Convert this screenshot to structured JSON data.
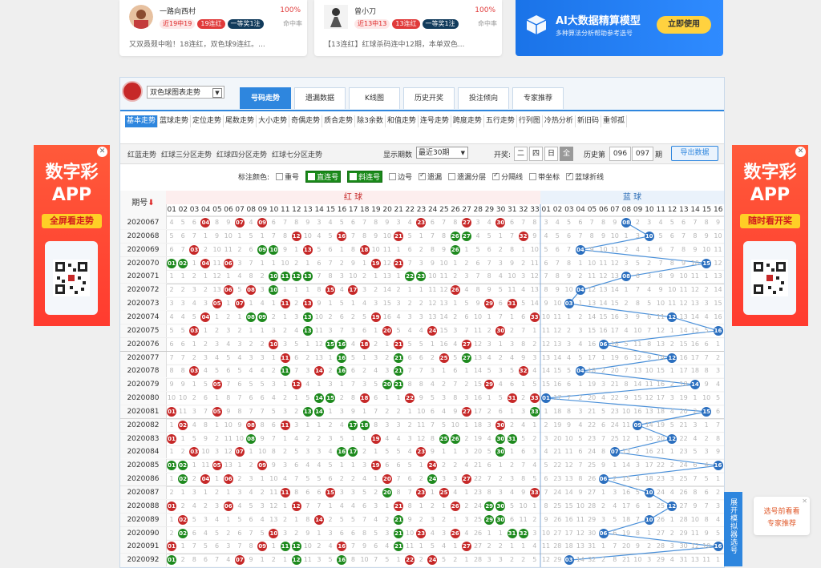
{
  "experts": [
    {
      "name": "一路向西村",
      "badges": [
        "近19中19",
        "19连红",
        "一等奖1注"
      ],
      "rate": "100%",
      "rate_label": "命中率",
      "desc": "又双叒叕中啦！18连红，双色球9连红。..."
    },
    {
      "name": "曾小刀",
      "badges": [
        "近13中13",
        "13连红",
        "一等奖1注"
      ],
      "rate": "100%",
      "rate_label": "命中率",
      "desc": "【13连红】红球杀码连中12期，本单双色..."
    }
  ],
  "ai_banner": {
    "title": "AI大数据精算模型",
    "subtitle": "多种算法分析帮助参考选号",
    "button": "立即使用"
  },
  "lottery_select": "双色球图表走势",
  "tabs": [
    "号码走势",
    "遗漏数据",
    "K线图",
    "历史开奖",
    "投注倾向",
    "专家推荐"
  ],
  "sub_tabs": [
    "基本走势",
    "蓝球走势",
    "定位走势",
    "尾数走势",
    "大小走势",
    "奇偶走势",
    "质合走势",
    "除3余数",
    "和值走势",
    "连号走势",
    "跨度走势",
    "五行走势",
    "行列图",
    "冷热分析",
    "新旧码",
    "重邻孤"
  ],
  "options": {
    "links": [
      "红蓝走势",
      "红球三分区走势",
      "红球四分区走势",
      "红球七分区走势"
    ],
    "period_label": "显示期数",
    "period_value": "最近30期",
    "open_label": "开奖:",
    "open_buttons": [
      "二",
      "四",
      "日",
      "全"
    ],
    "history_label": "历史第",
    "history_from": "096",
    "history_to": "097",
    "history_suffix": "期",
    "export": "导出数据"
  },
  "markers": {
    "label": "标注颜色:",
    "items": [
      {
        "label": "重号",
        "checked": false,
        "highlight": false
      },
      {
        "label": "直连号",
        "checked": true,
        "highlight": true
      },
      {
        "label": "斜连号",
        "checked": true,
        "highlight": true
      },
      {
        "label": "边号",
        "checked": false,
        "highlight": false
      },
      {
        "label": "遗漏",
        "checked": true,
        "highlight": false
      },
      {
        "label": "遗漏分层",
        "checked": false,
        "highlight": false
      },
      {
        "label": "分隔线",
        "checked": true,
        "highlight": false
      },
      {
        "label": "带坐标",
        "checked": false,
        "highlight": false
      },
      {
        "label": "蓝球折线",
        "checked": true,
        "highlight": false
      }
    ]
  },
  "table": {
    "period_header": "期号",
    "red_header": "红 球",
    "blue_header": "蓝 球",
    "red_numbers": [
      "01",
      "02",
      "03",
      "04",
      "05",
      "06",
      "07",
      "08",
      "09",
      "10",
      "11",
      "12",
      "13",
      "14",
      "15",
      "16",
      "17",
      "18",
      "19",
      "20",
      "21",
      "22",
      "23",
      "24",
      "25",
      "26",
      "27",
      "28",
      "29",
      "30",
      "31",
      "32",
      "33"
    ],
    "blue_numbers": [
      "01",
      "02",
      "03",
      "04",
      "05",
      "06",
      "07",
      "08",
      "09",
      "10",
      "11",
      "12",
      "13",
      "14",
      "15",
      "16"
    ],
    "rows": [
      {
        "period": "2020067",
        "red": [
          4,
          7,
          9,
          23,
          27,
          30
        ],
        "blue": 8
      },
      {
        "period": "2020068",
        "red": [
          12,
          16,
          21,
          26,
          27,
          32
        ],
        "blue": 10
      },
      {
        "period": "2020069",
        "red": [
          3,
          9,
          10,
          13,
          18,
          26
        ],
        "blue": 4
      },
      {
        "period": "2020070",
        "red": [
          1,
          2,
          4,
          6,
          19,
          21
        ],
        "blue": 15
      },
      {
        "period": "2020071",
        "red": [
          10,
          11,
          12,
          13,
          22,
          23
        ],
        "blue": 8
      },
      {
        "period": "2020072",
        "red": [
          6,
          8,
          10,
          15,
          17,
          26
        ],
        "blue": 4
      },
      {
        "period": "2020073",
        "red": [
          5,
          7,
          11,
          13,
          29,
          31
        ],
        "blue": 3
      },
      {
        "period": "2020074",
        "red": [
          4,
          8,
          9,
          13,
          19,
          33
        ],
        "blue": 12
      },
      {
        "period": "2020075",
        "red": [
          3,
          13,
          20,
          24,
          30
        ],
        "blue": 16
      },
      {
        "period": "2020076",
        "red": [
          10,
          15,
          16,
          18,
          21,
          27
        ],
        "blue": 6
      },
      {
        "period": "2020077",
        "red": [
          11,
          16,
          21,
          25,
          27
        ],
        "blue": 12
      },
      {
        "period": "2020078",
        "red": [
          3,
          11,
          14,
          16,
          21,
          32
        ],
        "blue": 4
      },
      {
        "period": "2020079",
        "red": [
          5,
          12,
          20,
          21,
          29
        ],
        "blue": 14
      },
      {
        "period": "2020080",
        "red": [
          14,
          15,
          18,
          22,
          31,
          33
        ],
        "blue": 1
      },
      {
        "period": "2020081",
        "red": [
          1,
          5,
          13,
          14,
          27,
          33
        ],
        "blue": 15
      },
      {
        "period": "2020082",
        "red": [
          2,
          8,
          11,
          17,
          18,
          30
        ],
        "blue": 9
      },
      {
        "period": "2020083",
        "red": [
          1,
          8,
          19,
          25,
          26,
          30,
          31
        ],
        "blue": 12
      },
      {
        "period": "2020084",
        "red": [
          3,
          7,
          16,
          17,
          23,
          30
        ],
        "blue": 7
      },
      {
        "period": "2020085",
        "red": [
          1,
          2,
          5,
          9,
          19,
          24
        ],
        "blue": 16
      },
      {
        "period": "2020086",
        "red": [
          2,
          4,
          6,
          20,
          24,
          27
        ],
        "blue": 6
      },
      {
        "period": "2020087",
        "red": [
          11,
          15,
          20,
          23,
          25,
          33
        ],
        "blue": 10
      },
      {
        "period": "2020088",
        "red": [
          1,
          6,
          12,
          21,
          26,
          29,
          30
        ],
        "blue": 12
      },
      {
        "period": "2020089",
        "red": [
          2,
          14,
          21,
          29,
          30
        ],
        "blue": 10
      },
      {
        "period": "2020090",
        "red": [
          2,
          10,
          21,
          23,
          26,
          31,
          32
        ],
        "blue": 6
      },
      {
        "period": "2020091",
        "red": [
          1,
          9,
          11,
          12,
          16,
          21,
          27
        ],
        "blue": 16
      },
      {
        "period": "2020092",
        "red": [
          1,
          7,
          12,
          16,
          22,
          24
        ],
        "blue": 3
      }
    ]
  },
  "side_ads": [
    {
      "line1": "数字彩",
      "line2": "APP",
      "pill": "全屏看走势"
    },
    {
      "line1": "数字彩",
      "line2": "APP",
      "pill": "随时看开奖"
    }
  ],
  "simulator_tab": "展开模拟器选号",
  "tip": {
    "line1": "选号前看看",
    "line2": "专家推荐"
  },
  "colors": {
    "accent": "#2e86de",
    "red_ball": "#c62828",
    "green_ball": "#1e8a1e",
    "blue_ball": "#2b6fbf",
    "ai_btn": "#ffd23f"
  }
}
